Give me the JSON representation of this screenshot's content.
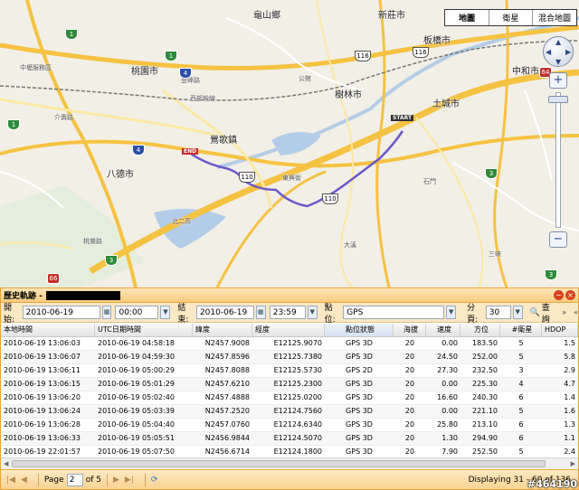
{
  "map": {
    "type_buttons": [
      "地圖",
      "衛星",
      "混合地圖"
    ],
    "active_type": "地圖",
    "labels": {
      "guishan": "龜山鄉",
      "xinzhuang": "新莊市",
      "banqiao": "板橋市",
      "zhonghe": "中和市",
      "taoyuan": "桃園市",
      "shulin": "樹林市",
      "tucheng": "土城市",
      "bade": "八德市",
      "yingge": "鶯歌鎮",
      "zhongkun": "中壢服務區",
      "xixi": "西部幹線",
      "dengfeng": "登峰路",
      "shimen": "石門",
      "dongxing": "東興街",
      "taibei_area": "三峽",
      "lukou": "大溪",
      "guixu": "公館",
      "chung": "北二高",
      "taozhu": "桃鶯路",
      "jieshou": "介壽路"
    },
    "markers": {
      "end": "END",
      "start": "START"
    },
    "route_color": "#6a58c8",
    "shields": [
      "1",
      "1",
      "1",
      "4",
      "4",
      "3",
      "3",
      "110",
      "110",
      "116",
      "116",
      "3",
      "64",
      "66"
    ]
  },
  "panel": {
    "title": "歷史軌跡 -",
    "controls": {
      "start_label": "開始:",
      "start_date": "2010-06-19",
      "start_time": "00:00",
      "end_label": "結束:",
      "end_date": "2010-06-19",
      "end_time": "23:59",
      "locate_label": "點位:",
      "locate_value": "GPS",
      "per_page_label": "分頁:",
      "per_page_value": "30",
      "query_label": "查詢"
    },
    "columns": [
      "本地時間",
      "UTC日期時間",
      "緯度",
      "經度",
      "點位狀態",
      "海拔",
      "速度",
      "方位",
      "#衛星",
      "HDOP"
    ],
    "rows": [
      [
        "2010-06-19 13:06:03",
        "2010-06-19 04:58:18",
        "N2457.9008",
        "E12125.9070",
        "GPS 3D",
        "20",
        "0.00",
        "183.50",
        "5",
        "1.5"
      ],
      [
        "2010-06-19 13:06:07",
        "2010-06-19 04:59:30",
        "N2457.8596",
        "E12125.7380",
        "GPS 3D",
        "20",
        "24.50",
        "252.00",
        "5",
        "5.8"
      ],
      [
        "2010-06-19 13:06:11",
        "2010-06-19 05:00:29",
        "N2457.8088",
        "E12125.5730",
        "GPS 2D",
        "20",
        "27.30",
        "232.50",
        "3",
        "2.9"
      ],
      [
        "2010-06-19 13:06:15",
        "2010-06-19 05:01:29",
        "N2457.6210",
        "E12125.2300",
        "GPS 3D",
        "20",
        "0.00",
        "225.30",
        "4",
        "4.7"
      ],
      [
        "2010-06-19 13:06:20",
        "2010-06-19 05:02:40",
        "N2457.4888",
        "E12125.0200",
        "GPS 3D",
        "20",
        "16.60",
        "240.30",
        "6",
        "1.4"
      ],
      [
        "2010-06-19 13:06:24",
        "2010-06-19 05:03:39",
        "N2457.2520",
        "E12124.7560",
        "GPS 3D",
        "20",
        "0.00",
        "221.10",
        "5",
        "1.6"
      ],
      [
        "2010-06-19 13:06:28",
        "2010-06-19 05:04:40",
        "N2457.0760",
        "E12124.6340",
        "GPS 3D",
        "20",
        "25.80",
        "213.10",
        "6",
        "1.3"
      ],
      [
        "2010-06-19 13:06:33",
        "2010-06-19 05:05:51",
        "N2456.9844",
        "E12124.5070",
        "GPS 3D",
        "20",
        "1.30",
        "294.90",
        "6",
        "1.1"
      ],
      [
        "2010-06-19 22:01:57",
        "2010-06-19 05:07:50",
        "N2456.6714",
        "E12124.1800",
        "GPS 3D",
        "20",
        "7.90",
        "252.50",
        "5",
        "2.4"
      ]
    ],
    "pager": {
      "page_label": "Page",
      "page_value": "2",
      "of_label": "of 5",
      "display_text": "Displaying 31 - 60 of 136"
    }
  },
  "watermark": "#464190"
}
